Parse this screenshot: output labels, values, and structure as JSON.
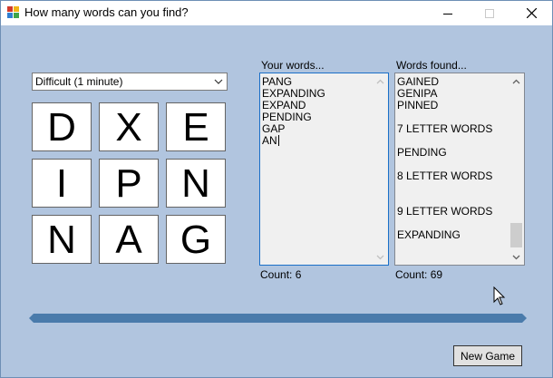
{
  "window": {
    "title": "How many words can you find?"
  },
  "difficulty": {
    "selected": "Difficult (1 minute)"
  },
  "grid": {
    "letters": [
      "D",
      "X",
      "E",
      "I",
      "P",
      "N",
      "N",
      "A",
      "G"
    ]
  },
  "your_words": {
    "label": "Your words...",
    "entries": [
      "PANG",
      "EXPANDING",
      "EXPAND",
      "PENDING",
      "GAP"
    ],
    "current": "AN",
    "count_text": "Count: 6"
  },
  "words_found": {
    "label": "Words found...",
    "lines": [
      "GAINED",
      "GENIPA",
      "PINNED",
      "",
      "7 LETTER WORDS",
      "",
      "PENDING",
      "",
      "8 LETTER WORDS",
      "",
      "",
      "9 LETTER WORDS",
      "",
      "EXPANDING"
    ],
    "count_text": "Count: 69"
  },
  "buttons": {
    "new_game": "New Game"
  },
  "progress": {
    "fraction": 1.0
  },
  "colors": {
    "background": "#b1c5df",
    "progress_fill": "#4a7bab",
    "focus_border": "#1a6fc8"
  },
  "icons": {
    "app": "app-icon",
    "minimize": "minimize-icon",
    "maximize": "maximize-icon",
    "close": "close-icon",
    "dropdown": "chevron-down-icon"
  }
}
